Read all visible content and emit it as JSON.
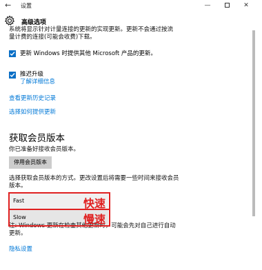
{
  "window": {
    "back_glyph": "←",
    "title": "设置",
    "minimize_glyph": "—",
    "close_glyph": "✕"
  },
  "header": {
    "icon": "gear-icon",
    "title": "高级选项"
  },
  "content": {
    "cut_text_line1": "系统将显示针对计量连接的更新的实现更新。更新不会通过按流",
    "cut_text_line2": "量计费的连接(可能会收费)下载。",
    "checkbox_microsoft": {
      "label": "更新 Windows 时提供其他 Microsoft 产品的更新。",
      "checked": true
    },
    "checkbox_defer": {
      "label": "推迟升级",
      "checked": true
    },
    "learn_more_link": "了解详细信息",
    "view_history_link": "查看更新历史记录",
    "choose_delivery_link": "选择如何提供更新",
    "insider_section": {
      "title": "获取会员版本",
      "ready_text": "你已准备好接收会员版本。",
      "stop_button": "停用会员版本",
      "choose_text_line1": "选择获取会员版本的方式。更改设置后将需要一些时间来接收会员",
      "choose_text_line2": "版本。",
      "ring_options": [
        {
          "label": "Fast",
          "selected": true
        },
        {
          "label": "Slow",
          "selected": false
        }
      ],
      "note_line1": "注: Windows 更新在检查其他更新时，可能会先对自己进行自动",
      "note_line2": "更新。"
    },
    "privacy_link": "隐私设置"
  },
  "annotations": {
    "fast_label": "快速",
    "slow_label": "慢速",
    "color": "#e02020"
  },
  "colors": {
    "accent": "#0a6fc6",
    "link": "#0078d7"
  }
}
